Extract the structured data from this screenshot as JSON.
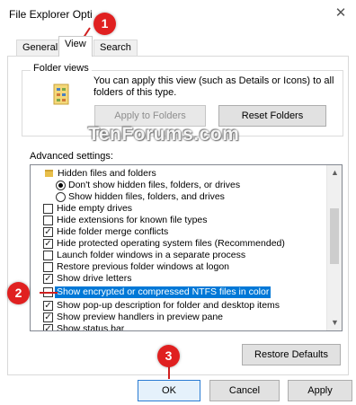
{
  "window": {
    "title": "File Explorer Opti",
    "close_glyph": "✕"
  },
  "tabs": [
    {
      "label": "General"
    },
    {
      "label": "View"
    },
    {
      "label": "Search"
    }
  ],
  "folder_views": {
    "label": "Folder views",
    "description": "You can apply this view (such as Details or Icons) to all folders of this type.",
    "apply_button": "Apply to Folders",
    "reset_button": "Reset Folders"
  },
  "watermark": "TenForums.com",
  "advanced": {
    "label": "Advanced settings:",
    "items": [
      {
        "type": "folder",
        "label": "Hidden files and folders"
      },
      {
        "type": "radio",
        "checked": true,
        "label": "Don't show hidden files, folders, or drives"
      },
      {
        "type": "radio",
        "checked": false,
        "label": "Show hidden files, folders, and drives"
      },
      {
        "type": "check",
        "checked": false,
        "label": "Hide empty drives"
      },
      {
        "type": "check",
        "checked": false,
        "label": "Hide extensions for known file types"
      },
      {
        "type": "check",
        "checked": true,
        "label": "Hide folder merge conflicts"
      },
      {
        "type": "check",
        "checked": true,
        "label": "Hide protected operating system files (Recommended)"
      },
      {
        "type": "check",
        "checked": false,
        "label": "Launch folder windows in a separate process"
      },
      {
        "type": "check",
        "checked": false,
        "label": "Restore previous folder windows at logon"
      },
      {
        "type": "check",
        "checked": true,
        "label": "Show drive letters"
      },
      {
        "type": "check",
        "checked": false,
        "label": "Show encrypted or compressed NTFS files in color",
        "highlight": true
      },
      {
        "type": "check",
        "checked": true,
        "label": "Show pop-up description for folder and desktop items"
      },
      {
        "type": "check",
        "checked": true,
        "label": "Show preview handlers in preview pane"
      },
      {
        "type": "check",
        "checked": false,
        "label": "Show status bar"
      }
    ]
  },
  "restore_defaults": "Restore Defaults",
  "footer": {
    "ok": "OK",
    "cancel": "Cancel",
    "apply": "Apply"
  },
  "badges": [
    "1",
    "2",
    "3"
  ],
  "colors": {
    "highlight": "#0078d7",
    "badge": "#e02020"
  }
}
